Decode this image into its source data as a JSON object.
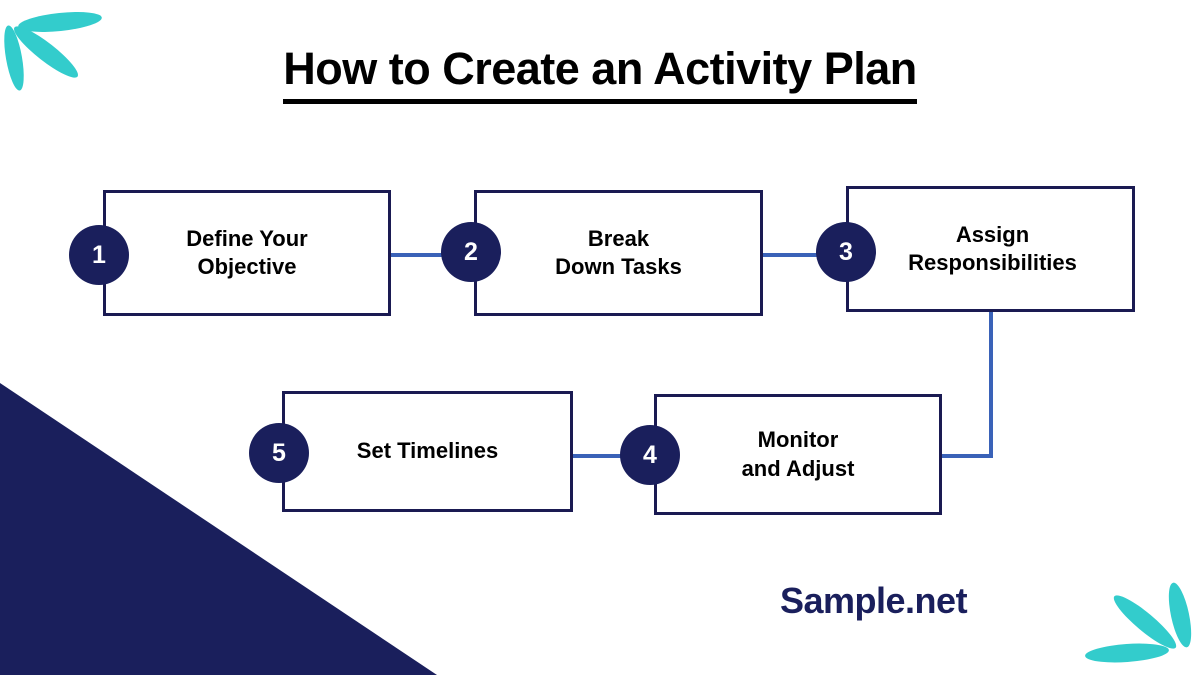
{
  "title": "How to Create an Activity Plan",
  "brand": "Sample.net",
  "colors": {
    "navy": "#1a1f5c",
    "box_border": "#1a1a52",
    "connector_blue": "#3a62b8",
    "teal": "#33CCCC",
    "text_black": "#000000",
    "background": "#FFFFFF"
  },
  "steps": [
    {
      "number": "1",
      "label": "Define Your\nObjective"
    },
    {
      "number": "2",
      "label": "Break\nDown Tasks"
    },
    {
      "number": "3",
      "label": "Assign\nResponsibilities"
    },
    {
      "number": "4",
      "label": "Monitor\nand Adjust"
    },
    {
      "number": "5",
      "label": "Set Timelines"
    }
  ],
  "decorations": {
    "top_left_leaves": "teal-leaf-cluster",
    "bottom_right_leaves": "teal-leaf-cluster",
    "bottom_left_triangle": "navy-corner-triangle"
  }
}
